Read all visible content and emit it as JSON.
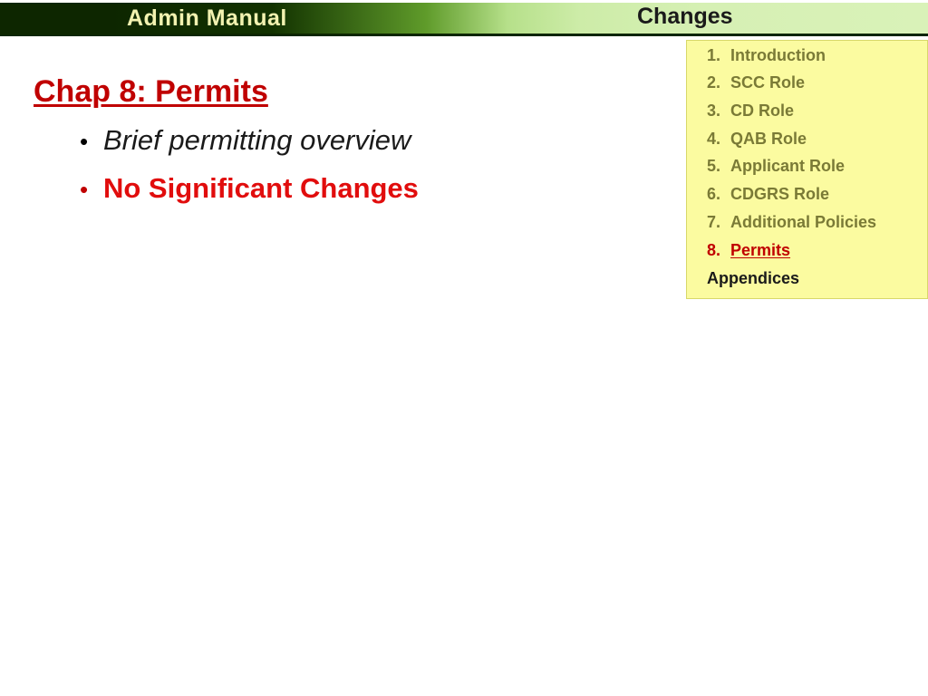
{
  "header": {
    "left_title": "Admin  Manual",
    "right_title": "Changes"
  },
  "slide": {
    "title": "Chap 8: Permits",
    "bullet_marker": "•",
    "bullets": [
      {
        "text": "Brief permitting overview",
        "style": "italic-black"
      },
      {
        "text": "No Significant Changes",
        "style": "bold-red"
      }
    ]
  },
  "agenda": {
    "items": [
      {
        "num": "1.",
        "label": "Introduction",
        "current": false
      },
      {
        "num": "2.",
        "label": "SCC Role",
        "current": false
      },
      {
        "num": "3.",
        "label": "CD Role",
        "current": false
      },
      {
        "num": "4.",
        "label": "QAB Role",
        "current": false
      },
      {
        "num": "5.",
        "label": "Applicant Role",
        "current": false
      },
      {
        "num": "6.",
        "label": "CDGRS Role",
        "current": false
      },
      {
        "num": "7.",
        "label": "Additional Policies",
        "current": false
      },
      {
        "num": "8.",
        "label": "Permits",
        "current": true
      }
    ],
    "appendix_label": "Appendices"
  },
  "colors": {
    "banner_dark": "#0d2600",
    "banner_light": "#d9f2b8",
    "accent_red": "#c00000",
    "bright_red": "#e10d0d",
    "agenda_bg": "#fbfba0",
    "agenda_text": "#7a7a36",
    "header_left_text": "#f2f2b0"
  }
}
